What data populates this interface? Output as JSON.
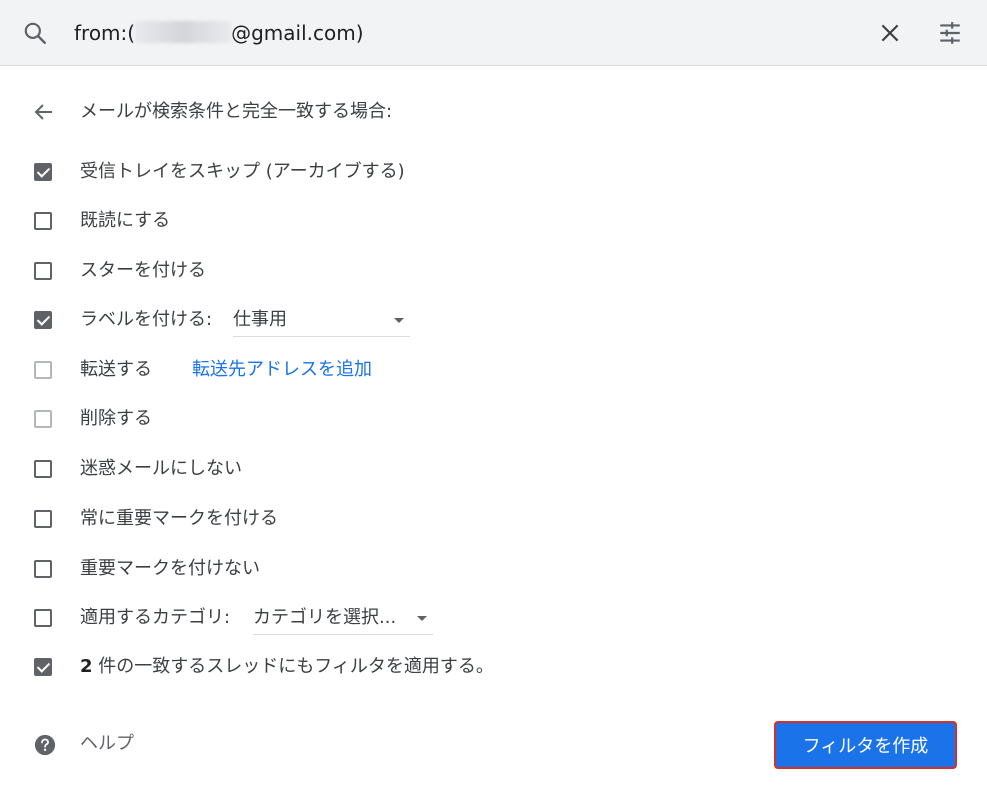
{
  "search": {
    "query_prefix": "from:(",
    "query_suffix": "@gmail.com)"
  },
  "filter": {
    "header": "メールが検索条件と完全一致する場合:",
    "options": {
      "skip_inbox": {
        "label": "受信トレイをスキップ (アーカイブする)",
        "checked": true
      },
      "mark_read": {
        "label": "既読にする",
        "checked": false
      },
      "star": {
        "label": "スターを付ける",
        "checked": false
      },
      "apply_label": {
        "label": "ラベルを付ける:",
        "checked": true,
        "select_value": "仕事用"
      },
      "forward": {
        "label": "転送する",
        "checked": false,
        "link": "転送先アドレスを追加"
      },
      "delete": {
        "label": "削除する",
        "checked": false
      },
      "never_spam": {
        "label": "迷惑メールにしない",
        "checked": false
      },
      "always_important": {
        "label": "常に重要マークを付ける",
        "checked": false
      },
      "never_important": {
        "label": "重要マークを付けない",
        "checked": false
      },
      "category": {
        "label": "適用するカテゴリ:",
        "checked": false,
        "select_value": "カテゴリを選択..."
      },
      "apply_existing": {
        "count": "2",
        "label": "件の一致するスレッドにもフィルタを適用する。",
        "checked": true
      }
    }
  },
  "footer": {
    "help_label": "ヘルプ",
    "create_button": "フィルタを作成"
  },
  "colors": {
    "accent": "#1a73e8",
    "highlight_border": "#d93025",
    "checkbox": "#5f6368"
  }
}
